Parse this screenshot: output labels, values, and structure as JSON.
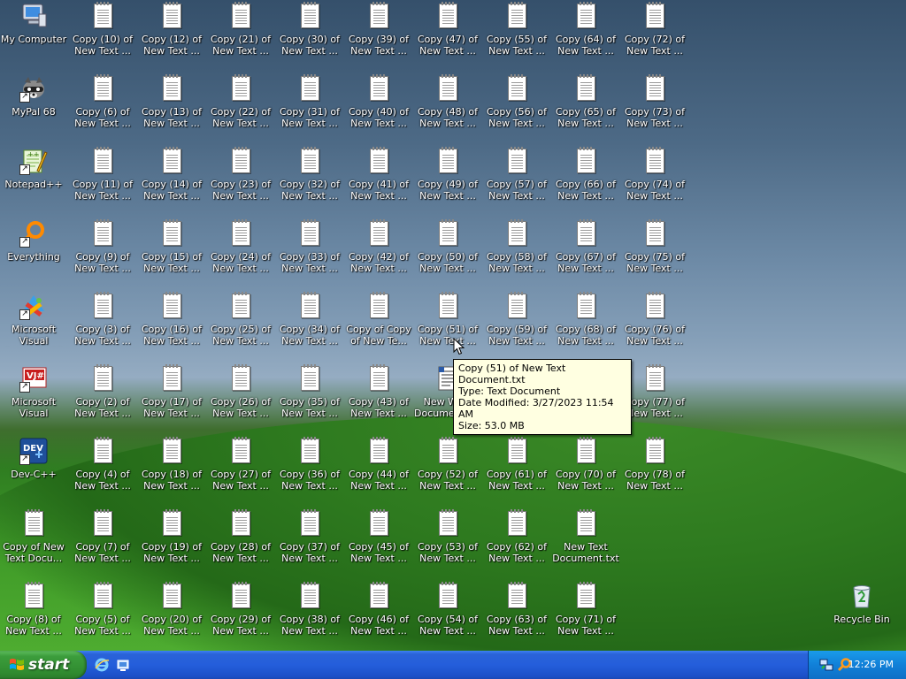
{
  "desktop": {
    "icons": [
      {
        "label": "My Computer",
        "kind": "computer"
      },
      {
        "label": "Copy (10) of\nNew Text ...",
        "kind": "doc"
      },
      {
        "label": "Copy (12) of\nNew Text ...",
        "kind": "doc"
      },
      {
        "label": "Copy (21) of\nNew Text ...",
        "kind": "doc"
      },
      {
        "label": "Copy (30) of\nNew Text ...",
        "kind": "doc"
      },
      {
        "label": "Copy (39) of\nNew Text ...",
        "kind": "doc"
      },
      {
        "label": "Copy (47) of\nNew Text ...",
        "kind": "doc"
      },
      {
        "label": "Copy (55) of\nNew Text ...",
        "kind": "doc"
      },
      {
        "label": "Copy (64) of\nNew Text ...",
        "kind": "doc"
      },
      {
        "label": "Copy (72) of\nNew Text ...",
        "kind": "doc"
      },
      {
        "label": "MyPal 68",
        "kind": "raccoon"
      },
      {
        "label": "Copy (6) of\nNew Text ...",
        "kind": "doc"
      },
      {
        "label": "Copy (13) of\nNew Text ...",
        "kind": "doc"
      },
      {
        "label": "Copy (22) of\nNew Text ...",
        "kind": "doc"
      },
      {
        "label": "Copy (31) of\nNew Text ...",
        "kind": "doc"
      },
      {
        "label": "Copy (40) of\nNew Text ...",
        "kind": "doc"
      },
      {
        "label": "Copy (48) of\nNew Text ...",
        "kind": "doc"
      },
      {
        "label": "Copy (56) of\nNew Text ...",
        "kind": "doc"
      },
      {
        "label": "Copy (65) of\nNew Text ...",
        "kind": "doc"
      },
      {
        "label": "Copy (73) of\nNew Text ...",
        "kind": "doc"
      },
      {
        "label": "Notepad++",
        "kind": "notepadpp"
      },
      {
        "label": "Copy (11) of\nNew Text ...",
        "kind": "doc"
      },
      {
        "label": "Copy (14) of\nNew Text ...",
        "kind": "doc"
      },
      {
        "label": "Copy (23) of\nNew Text ...",
        "kind": "doc"
      },
      {
        "label": "Copy (32) of\nNew Text ...",
        "kind": "doc"
      },
      {
        "label": "Copy (41) of\nNew Text ...",
        "kind": "doc"
      },
      {
        "label": "Copy (49) of\nNew Text ...",
        "kind": "doc"
      },
      {
        "label": "Copy (57) of\nNew Text ...",
        "kind": "doc"
      },
      {
        "label": "Copy (66) of\nNew Text ...",
        "kind": "doc"
      },
      {
        "label": "Copy (74) of\nNew Text ...",
        "kind": "doc"
      },
      {
        "label": "Everything",
        "kind": "everything"
      },
      {
        "label": "Copy (9) of\nNew Text ...",
        "kind": "doc"
      },
      {
        "label": "Copy (15) of\nNew Text ...",
        "kind": "doc"
      },
      {
        "label": "Copy (24) of\nNew Text ...",
        "kind": "doc"
      },
      {
        "label": "Copy (33) of\nNew Text ...",
        "kind": "doc"
      },
      {
        "label": "Copy (42) of\nNew Text ...",
        "kind": "doc"
      },
      {
        "label": "Copy (50) of\nNew Text ...",
        "kind": "doc"
      },
      {
        "label": "Copy (58) of\nNew Text ...",
        "kind": "doc"
      },
      {
        "label": "Copy (67) of\nNew Text ...",
        "kind": "doc"
      },
      {
        "label": "Copy (75) of\nNew Text ...",
        "kind": "doc"
      },
      {
        "label": "Microsoft Visual\nStudio 2005",
        "kind": "vs"
      },
      {
        "label": "Copy (3) of\nNew Text ...",
        "kind": "doc"
      },
      {
        "label": "Copy (16) of\nNew Text ...",
        "kind": "doc"
      },
      {
        "label": "Copy (25) of\nNew Text ...",
        "kind": "doc"
      },
      {
        "label": "Copy (34) of\nNew Text ...",
        "kind": "doc"
      },
      {
        "label": "Copy of Copy\nof New Te...",
        "kind": "doc"
      },
      {
        "label": "Copy (51) of\nNew Text ...",
        "kind": "doc"
      },
      {
        "label": "Copy (59) of\nNew Text ...",
        "kind": "doc"
      },
      {
        "label": "Copy (68) of\nNew Text ...",
        "kind": "doc"
      },
      {
        "label": "Copy (76) of\nNew Text ...",
        "kind": "doc"
      },
      {
        "label": "Microsoft Visual\nJ# 2005 Exp...",
        "kind": "vj"
      },
      {
        "label": "Copy (2) of\nNew Text ...",
        "kind": "doc"
      },
      {
        "label": "Copy (17) of\nNew Text ...",
        "kind": "doc"
      },
      {
        "label": "Copy (26) of\nNew Text ...",
        "kind": "doc"
      },
      {
        "label": "Copy (35) of\nNew Text ...",
        "kind": "doc"
      },
      {
        "label": "Copy (43) of\nNew Text ...",
        "kind": "doc"
      },
      {
        "label": "New Wo...\nDocument.doc",
        "kind": "worddoc"
      },
      {
        "label": "",
        "kind": "hidden"
      },
      {
        "label": "",
        "kind": "hidden"
      },
      {
        "label": "Copy (77) of\nNew Text ...",
        "kind": "doc"
      },
      {
        "label": "Dev-C++",
        "kind": "devcpp"
      },
      {
        "label": "Copy (4) of\nNew Text ...",
        "kind": "doc"
      },
      {
        "label": "Copy (18) of\nNew Text ...",
        "kind": "doc"
      },
      {
        "label": "Copy (27) of\nNew Text ...",
        "kind": "doc"
      },
      {
        "label": "Copy (36) of\nNew Text ...",
        "kind": "doc"
      },
      {
        "label": "Copy (44) of\nNew Text ...",
        "kind": "doc"
      },
      {
        "label": "Copy (52) of\nNew Text ...",
        "kind": "doc"
      },
      {
        "label": "Copy (61) of\nNew Text ...",
        "kind": "doc"
      },
      {
        "label": "Copy (70) of\nNew Text ...",
        "kind": "doc"
      },
      {
        "label": "Copy (78) of\nNew Text ...",
        "kind": "doc"
      },
      {
        "label": "Copy of New\nText Docu...",
        "kind": "doc"
      },
      {
        "label": "Copy (7) of\nNew Text ...",
        "kind": "doc"
      },
      {
        "label": "Copy (19) of\nNew Text ...",
        "kind": "doc"
      },
      {
        "label": "Copy (28) of\nNew Text ...",
        "kind": "doc"
      },
      {
        "label": "Copy (37) of\nNew Text ...",
        "kind": "doc"
      },
      {
        "label": "Copy (45) of\nNew Text ...",
        "kind": "doc"
      },
      {
        "label": "Copy (53) of\nNew Text ...",
        "kind": "doc"
      },
      {
        "label": "Copy (62) of\nNew Text ...",
        "kind": "doc"
      },
      {
        "label": "New Text\nDocument.txt",
        "kind": "doc"
      },
      {
        "label": "",
        "kind": "hidden"
      },
      {
        "label": "Copy (8) of\nNew Text ...",
        "kind": "doc"
      },
      {
        "label": "Copy (5) of\nNew Text ...",
        "kind": "doc"
      },
      {
        "label": "Copy (20) of\nNew Text ...",
        "kind": "doc"
      },
      {
        "label": "Copy (29) of\nNew Text ...",
        "kind": "doc"
      },
      {
        "label": "Copy (38) of\nNew Text ...",
        "kind": "doc"
      },
      {
        "label": "Copy (46) of\nNew Text ...",
        "kind": "doc"
      },
      {
        "label": "Copy (54) of\nNew Text ...",
        "kind": "doc"
      },
      {
        "label": "Copy (63) of\nNew Text ...",
        "kind": "doc"
      },
      {
        "label": "Copy (71) of\nNew Text ...",
        "kind": "doc"
      },
      {
        "label": "",
        "kind": "hidden"
      }
    ],
    "recycle_bin": {
      "label": "Recycle Bin"
    }
  },
  "tooltip": {
    "name": "Copy (51) of New Text Document.txt",
    "type": "Type: Text Document",
    "modified": "Date Modified: 3/27/2023 11:54 AM",
    "size": "Size: 53.0 MB"
  },
  "taskbar": {
    "start_label": "start",
    "quick_launch": [
      "ie-icon",
      "show-desktop-icon"
    ],
    "tray_icons": [
      "network-icon",
      "search-icon"
    ],
    "clock": "12:26 PM"
  },
  "colors": {
    "taskbar": "#245edb",
    "start": "#3c9d3c",
    "tray": "#1180d8",
    "tooltip": "#ffffe1"
  }
}
